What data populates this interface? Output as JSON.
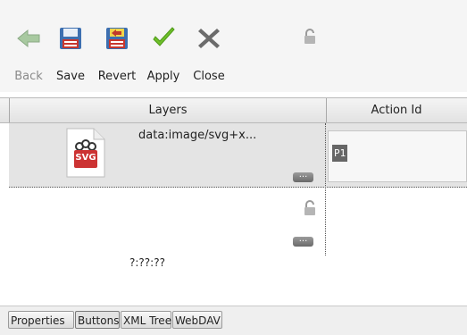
{
  "toolbar": {
    "buttons": [
      {
        "label": "Back",
        "icon": "back-arrow-icon",
        "enabled": false
      },
      {
        "label": "Save",
        "icon": "floppy-disk-icon",
        "enabled": true
      },
      {
        "label": "Revert",
        "icon": "revert-icon",
        "enabled": true
      },
      {
        "label": "Apply",
        "icon": "checkmark-icon",
        "enabled": true
      },
      {
        "label": "Close",
        "icon": "close-x-icon",
        "enabled": true
      }
    ]
  },
  "table": {
    "columns": [
      "Layers",
      "Action Id"
    ],
    "rows": [
      {
        "layer_name": "data:image/svg+x...",
        "icon": "svg-file-icon",
        "icon_text": "SVG",
        "action_id": "P1",
        "more_label": "..."
      },
      {
        "layer_name": "?:??:??",
        "more_label": "..."
      }
    ]
  },
  "tabs": [
    "Properties",
    "Buttons",
    "XML Tree",
    "WebDAV"
  ],
  "active_tab": "Buttons",
  "colors": {
    "selected_row": "#e4e4e4",
    "apply_green": "#6fbf2a",
    "close_gray": "#6b6b6b",
    "save_blue": "#3d6fb0",
    "revert_red": "#c03a2b"
  }
}
